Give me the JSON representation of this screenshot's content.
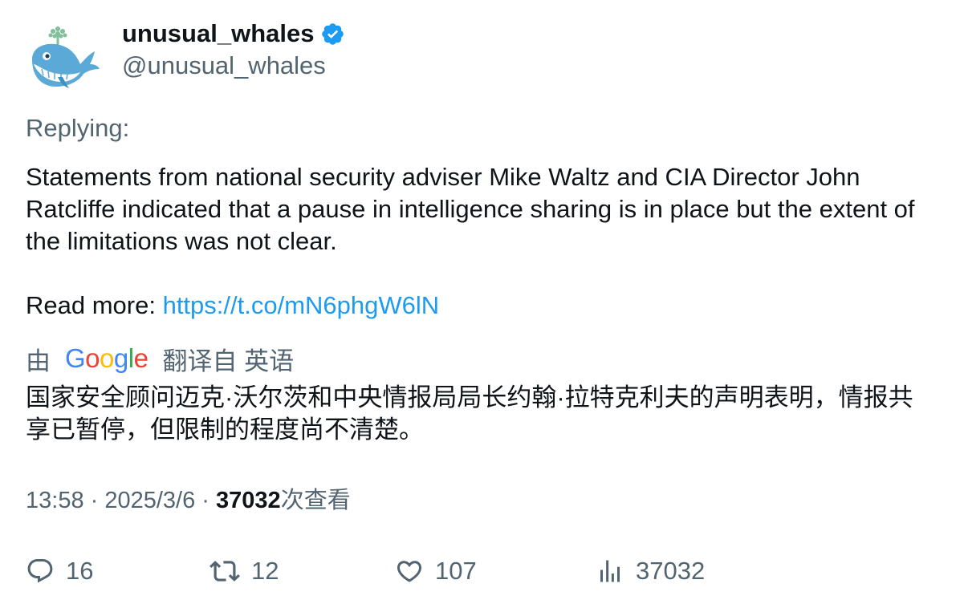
{
  "author": {
    "display_name": "unusual_whales",
    "handle": "@unusual_whales",
    "verified": true,
    "avatar_icon": "whale-icon",
    "verified_color": "#1d9bf0"
  },
  "reply_context": {
    "label": "Replying:"
  },
  "tweet": {
    "text": "Statements from national security adviser Mike Waltz and CIA Director John Ratcliffe indicated that a pause in intelligence sharing is in place but the extent of the limitations was not clear.",
    "read_more_label": "Read more: ",
    "link_text": "https://t.co/mN6phgW6lN"
  },
  "translation": {
    "by_label": "由",
    "google_letters": [
      "G",
      "o",
      "o",
      "g",
      "l",
      "e"
    ],
    "translated_from_label": "翻译自 英语",
    "text": "国家安全顾问迈克·沃尔茨和中央情报局局长约翰·拉特克利夫的声明表明，情报共享已暂停，但限制的程度尚不清楚。"
  },
  "meta": {
    "time": "13:58",
    "separator": " · ",
    "date": "2025/3/6",
    "views_count": "37032",
    "views_suffix": "次查看"
  },
  "actions": {
    "reply_count": "16",
    "retweet_count": "12",
    "like_count": "107",
    "views_count": "37032"
  },
  "colors": {
    "text_primary": "#0f1419",
    "text_secondary": "#536471",
    "link": "#1d9bf0",
    "google_blue": "#4285f4",
    "google_red": "#ea4335",
    "google_yellow": "#fbbc05",
    "google_green": "#34a853"
  }
}
